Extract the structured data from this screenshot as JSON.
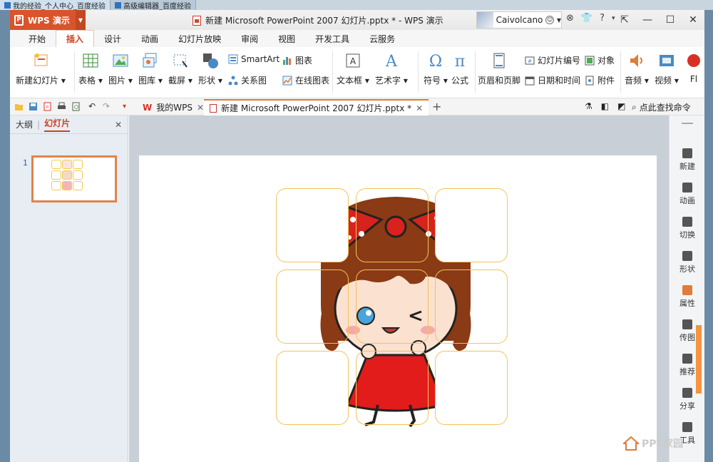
{
  "os_tabs": [
    "我的经验_个人中心_百度经验",
    "高级编辑器_百度经验"
  ],
  "app": {
    "brand": "WPS 演示",
    "title": "新建 Microsoft PowerPoint 2007 幻灯片.pptx * - WPS 演示",
    "user": "Caivolcano",
    "accent": "#d9542b"
  },
  "menu": {
    "tabs": [
      "开始",
      "插入",
      "设计",
      "动画",
      "幻灯片放映",
      "审阅",
      "视图",
      "开发工具",
      "云服务"
    ],
    "active": "插入"
  },
  "ribbon": {
    "new_slide": "新建幻灯片",
    "table": "表格",
    "picture": "图片",
    "gallery": "图库",
    "screenshot": "截屏",
    "shape": "形状",
    "smartart": "SmartArt",
    "chart": "图表",
    "relation": "关系图",
    "online_chart": "在线图表",
    "textbox": "文本框",
    "wordart": "艺术字",
    "symbol": "符号",
    "formula": "公式",
    "header_footer": "页眉和页脚",
    "slide_number": "幻灯片编号",
    "object": "对象",
    "datetime": "日期和时间",
    "attachment": "附件",
    "audio": "音频",
    "video": "视频",
    "flash": "Fl"
  },
  "doc_tabs": {
    "home": "我的WPS",
    "doc": "新建 Microsoft PowerPoint 2007 幻灯片.pptx *",
    "search": "点此查找命令"
  },
  "left_panel": {
    "outline": "大纲",
    "slides": "幻灯片",
    "slide_number": "1"
  },
  "right_panel": {
    "items": [
      "新建",
      "动画",
      "切换",
      "形状",
      "属性",
      "传图",
      "推荐",
      "分享",
      "工具"
    ]
  },
  "watermark": "PPT家园"
}
